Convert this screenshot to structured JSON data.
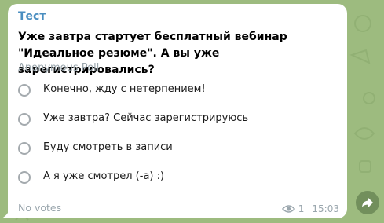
{
  "message": {
    "sender": "Тест",
    "time": "15:03",
    "views": "1"
  },
  "poll": {
    "question": "Уже завтра стартует бесплатный вебинар \"Идеальное резюме\". А вы уже зарегистрировались?",
    "type_label": "Anonymous Poll",
    "options": [
      {
        "label": "Конечно, жду с нетерпением!"
      },
      {
        "label": "Уже завтра? Сейчас зарегистрируюсь"
      },
      {
        "label": "Буду смотреть в записи"
      },
      {
        "label": "А я уже смотрел (-а) :)"
      }
    ],
    "votes_label": "No votes"
  },
  "icons": {
    "views": "eye-icon",
    "share": "share-arrow-icon",
    "option": "radio-circle-icon"
  },
  "colors": {
    "background": "#9dbb7f",
    "bubble": "#ffffff",
    "sender": "#4a8ec0",
    "muted": "#9aa6ad"
  }
}
